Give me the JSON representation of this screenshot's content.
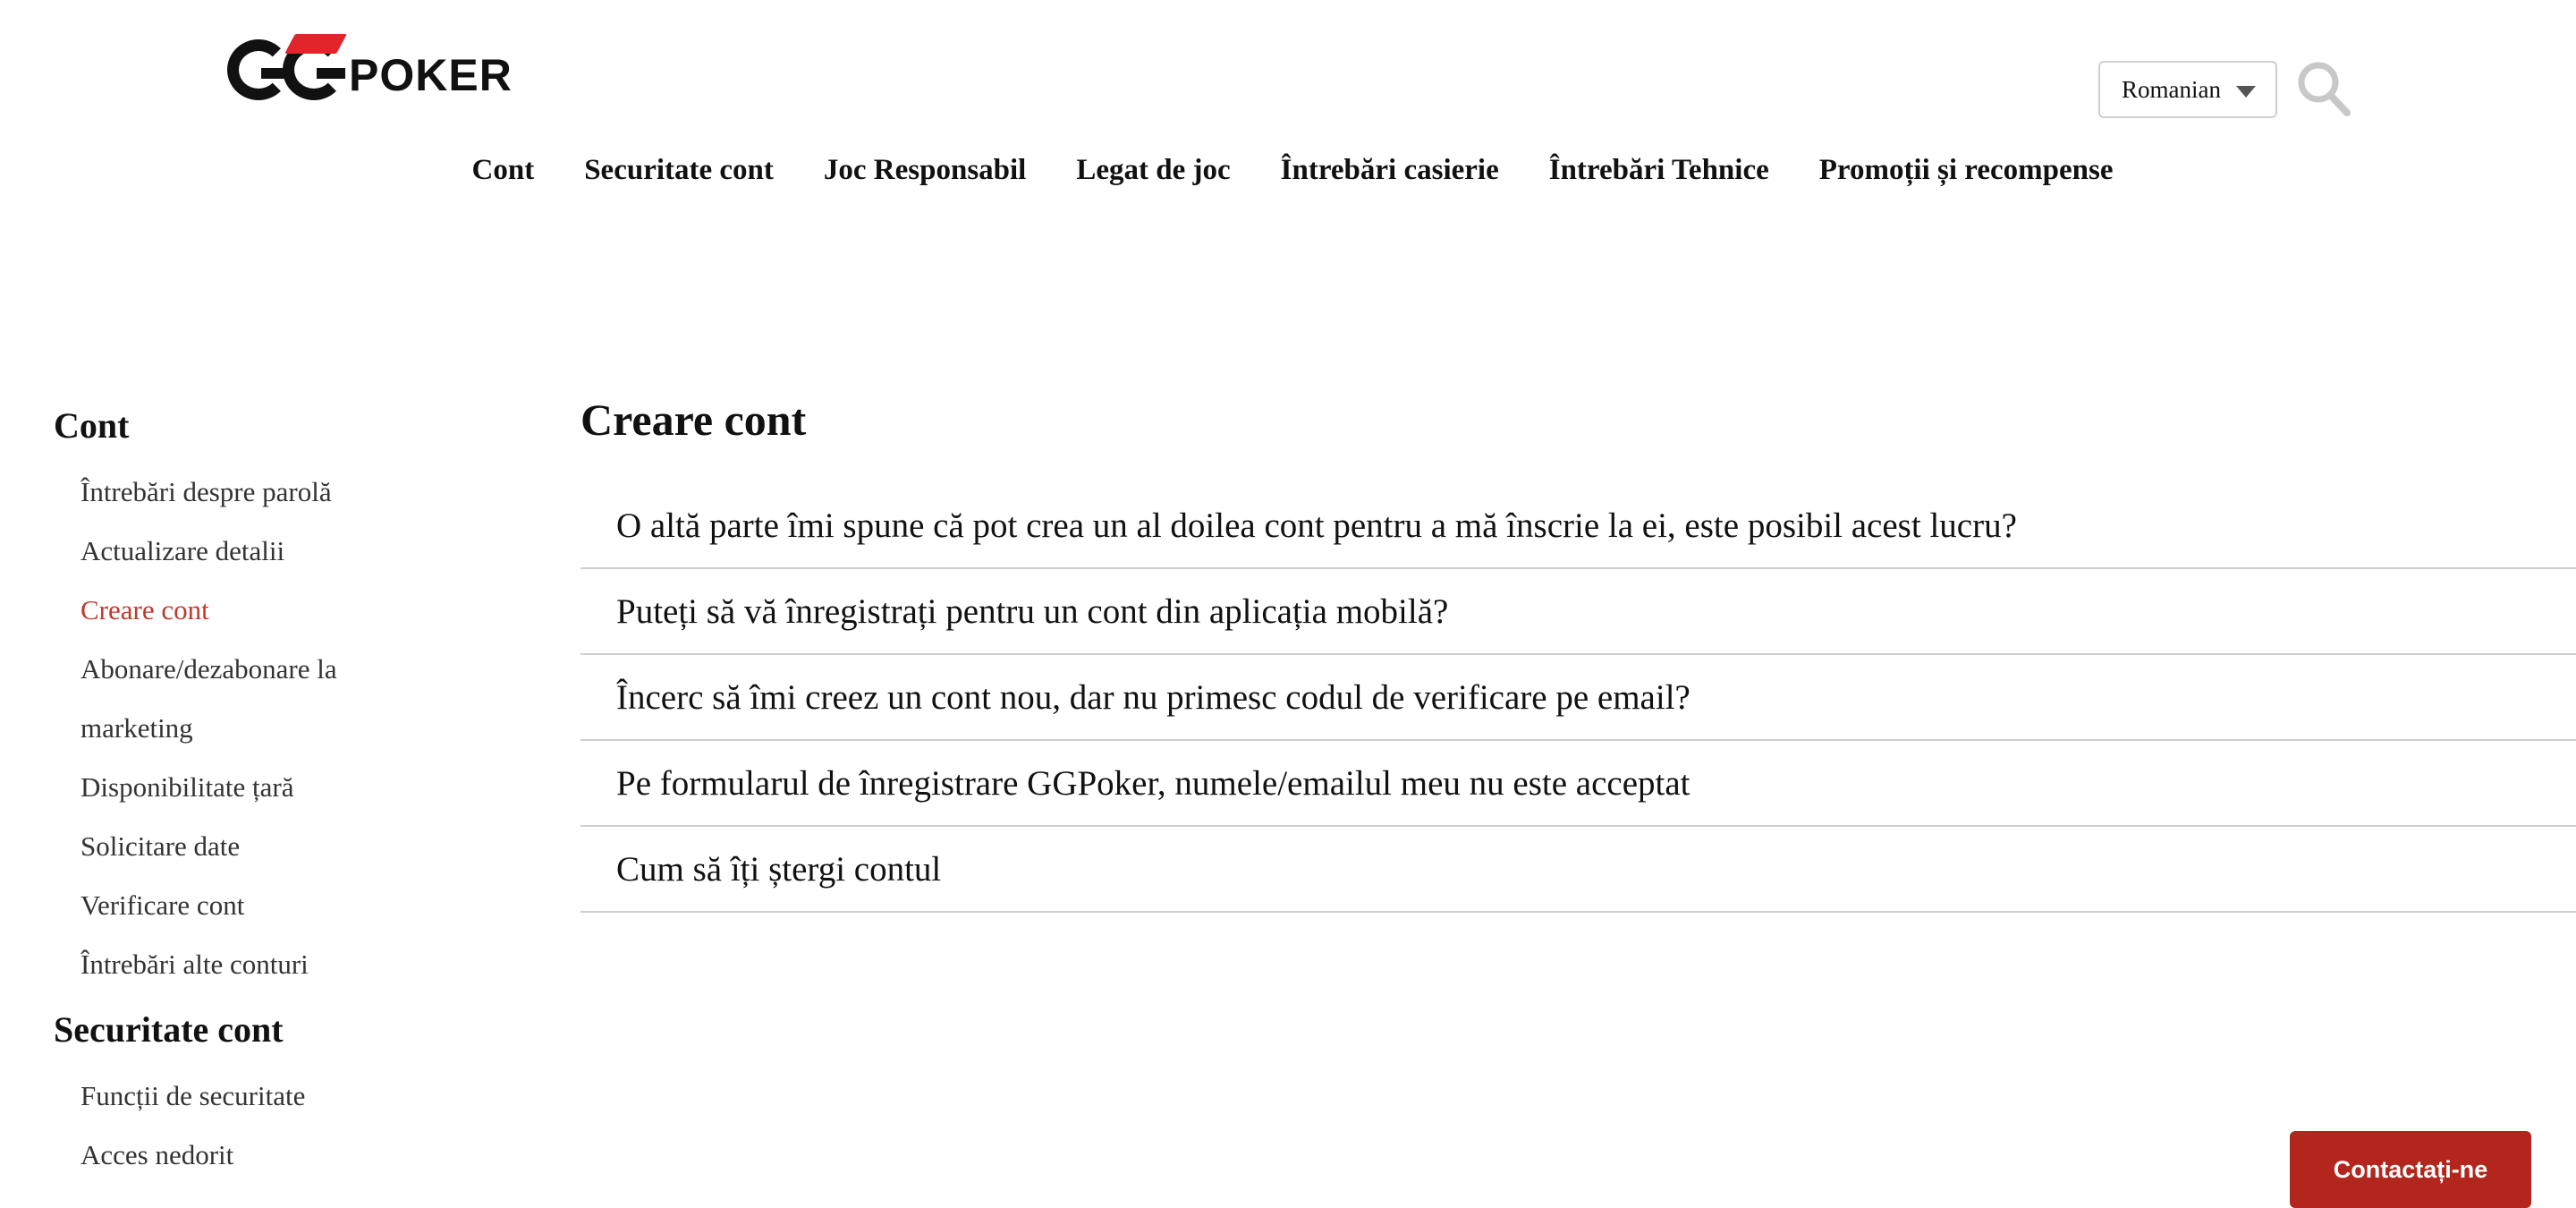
{
  "header": {
    "logo_text": "POKER",
    "language": {
      "selected": "Romanian"
    }
  },
  "topnav": [
    {
      "label": "Cont"
    },
    {
      "label": "Securitate cont"
    },
    {
      "label": "Joc Responsabil"
    },
    {
      "label": "Legat de joc"
    },
    {
      "label": "Întrebări casierie"
    },
    {
      "label": "Întrebări Tehnice"
    },
    {
      "label": "Promoții și recompense"
    }
  ],
  "sidebar": {
    "section1": {
      "title": "Cont",
      "items": [
        {
          "label": "Întrebări despre parolă"
        },
        {
          "label": "Actualizare detalii"
        },
        {
          "label": "Creare cont",
          "active": true
        },
        {
          "label": "Abonare/dezabonare la marketing"
        },
        {
          "label": "Disponibilitate țară"
        },
        {
          "label": "Solicitare date"
        },
        {
          "label": "Verificare cont"
        },
        {
          "label": "Întrebări alte conturi"
        }
      ]
    },
    "section2": {
      "title": "Securitate cont",
      "items": [
        {
          "label": "Funcții de securitate"
        },
        {
          "label": "Acces nedorit"
        }
      ]
    }
  },
  "main": {
    "title": "Creare cont",
    "faq": [
      {
        "question": "O altă parte îmi spune că pot crea un al doilea cont pentru a mă înscrie la ei, este posibil acest lucru?"
      },
      {
        "question": "Puteți să vă înregistrați pentru un cont din aplicația mobilă?"
      },
      {
        "question": "Încerc să îmi creez un cont nou, dar nu primesc codul de verificare pe email?"
      },
      {
        "question": "Pe formularul de înregistrare GGPoker, numele/emailul meu nu este acceptat"
      },
      {
        "question": "Cum să îți ștergi contul"
      }
    ]
  },
  "contact_button": {
    "label": "Contactați-ne"
  },
  "colors": {
    "active_link": "#c0392b",
    "contact_button_bg": "#b3261e",
    "logo_red": "#e0262b"
  }
}
